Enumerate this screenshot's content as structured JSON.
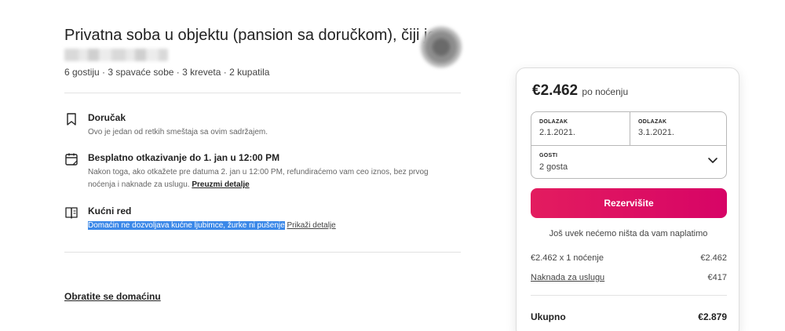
{
  "listing": {
    "title": "Privatna soba u objektu (pansion sa doručkom), čiji je",
    "host_avatar_icon": "blurred-avatar",
    "details": "6 gostiju · 3 spavaće sobe · 3 kreveta · 2 kupatila"
  },
  "features": [
    {
      "icon": "bookmark-icon",
      "title": "Doručak",
      "desc": "Ovo je jedan od retkih smeštaja sa ovim sadržajem."
    },
    {
      "icon": "calendar-icon",
      "title": "Besplatno otkazivanje do 1. jan u 12:00 PM",
      "desc": "Nakon toga, ako otkažete pre datuma 2. jan u 12:00 PM, refundiraćemo vam ceo iznos, bez prvog noćenja i naknade za uslugu.",
      "link": "Preuzmi detalje"
    },
    {
      "icon": "book-icon",
      "title": "Kućni red",
      "desc_selected": "Domaćin ne dozvoljava kućne ljubimce, žurke ni pušenje",
      "link": "Prikaži detalje"
    }
  ],
  "contact_link": "Obratite se domaćinu",
  "booking": {
    "price": "€2.462",
    "per_night": "po noćenju",
    "checkin_label": "DOLAZAK",
    "checkin_value": "2.1.2021.",
    "checkout_label": "ODLAZAK",
    "checkout_value": "3.1.2021.",
    "guests_label": "GOSTI",
    "guests_value": "2 gosta",
    "reserve_button": "Rezervišite",
    "note": "Još uvek nećemo ništa da vam naplatimo",
    "line1_label": "€2.462 x 1 noćenje",
    "line1_value": "€2.462",
    "line2_label": "Naknada za uslugu",
    "line2_value": "€417",
    "total_label": "Ukupno",
    "total_value": "€2.879",
    "accent_color": "#e31c5f"
  }
}
